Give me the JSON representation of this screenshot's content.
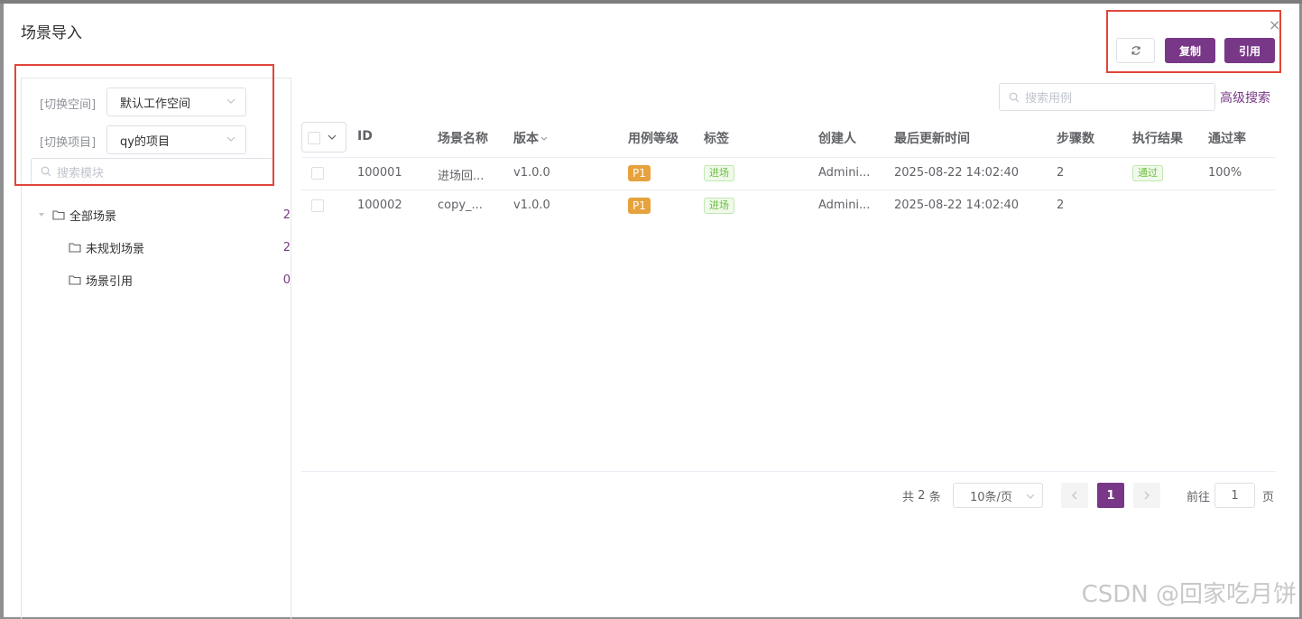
{
  "dialog": {
    "title": "场景导入",
    "close": "×"
  },
  "toolbar": {
    "copy_label": "复制",
    "reference_label": "引用",
    "refresh_icon": "refresh-icon"
  },
  "sidebar": {
    "workspace_label": "[切换空间]",
    "workspace_value": "默认工作空间",
    "project_label": "[切换项目]",
    "project_value": "qy的项目",
    "search_placeholder": "搜索模块",
    "tree": [
      {
        "label": "全部场景",
        "count": "2"
      },
      {
        "label": "未规划场景",
        "count": "2"
      },
      {
        "label": "场景引用",
        "count": "0"
      }
    ]
  },
  "search": {
    "placeholder": "搜索用例",
    "advanced_label": "高级搜索"
  },
  "table": {
    "headers": [
      "ID",
      "场景名称",
      "版本",
      "用例等级",
      "标签",
      "创建人",
      "最后更新时间",
      "步骤数",
      "执行结果",
      "通过率"
    ],
    "rows": [
      {
        "id": "100001",
        "name": "进场回...",
        "version": "v1.0.0",
        "level": "P1",
        "tag": "进场",
        "creator": "Admini...",
        "updated": "2025-08-22 14:02:40",
        "steps": "2",
        "result": "通过",
        "pass_rate": "100%"
      },
      {
        "id": "100002",
        "name": "copy_...",
        "version": "v1.0.0",
        "level": "P1",
        "tag": "进场",
        "creator": "Admini...",
        "updated": "2025-08-22 14:02:40",
        "steps": "2",
        "result": "",
        "pass_rate": ""
      }
    ]
  },
  "pagination": {
    "total_prefix": "共",
    "total": "2",
    "total_suffix": "条",
    "page_size": "10条/页",
    "current_page": "1",
    "goto_label": "前往",
    "goto_value": "1",
    "goto_suffix": "页"
  },
  "watermark": "CSDN @回家吃月饼",
  "colors": {
    "primary": "#783887",
    "highlight_box": "#e0453a",
    "tag_p1": "#e6a23c",
    "success": "#67c23a"
  }
}
